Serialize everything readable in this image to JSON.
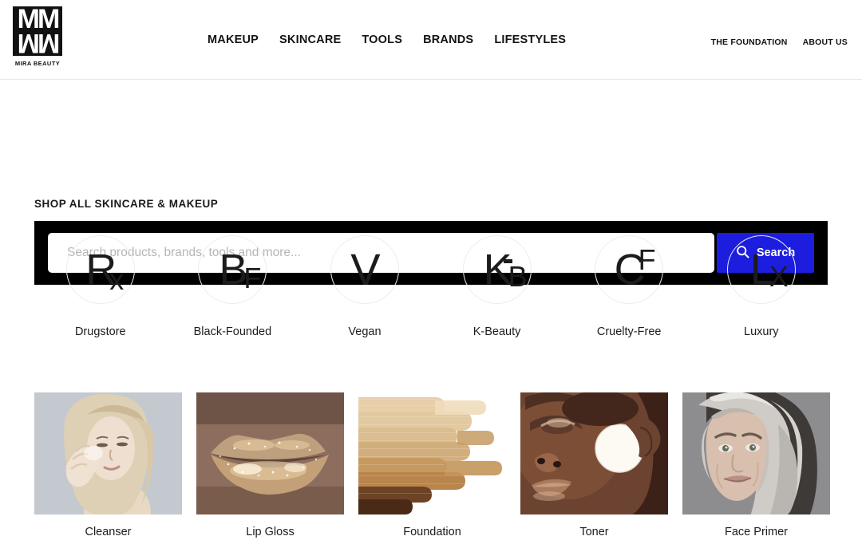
{
  "header": {
    "logo": {
      "mark_top": "MM",
      "mark_bottom": "MM",
      "wordmark": "MIRA BEAUTY"
    },
    "nav": [
      {
        "label": "MAKEUP"
      },
      {
        "label": "SKINCARE"
      },
      {
        "label": "TOOLS"
      },
      {
        "label": "BRANDS"
      },
      {
        "label": "LIFESTYLES"
      }
    ],
    "util_nav": [
      {
        "label": "THE FOUNDATION"
      },
      {
        "label": "ABOUT US"
      }
    ]
  },
  "search": {
    "section_title": "SHOP ALL SKINCARE & MAKEUP",
    "placeholder": "Search products, brands, tools and more...",
    "value": "",
    "button_label": "Search",
    "button_icon": "search-icon",
    "button_color": "#1d1de0",
    "band_color": "#000000"
  },
  "categories": [
    {
      "label": "Drugstore",
      "icon": "rx-monogram-icon",
      "glyph_main": "R",
      "glyph_sub": "x"
    },
    {
      "label": "Black-Founded",
      "icon": "bf-monogram-icon",
      "glyph_main": "B",
      "glyph_sub": "F"
    },
    {
      "label": "Vegan",
      "icon": "v-monogram-icon",
      "glyph_main": "V",
      "glyph_sub": ""
    },
    {
      "label": "K-Beauty",
      "icon": "kb-monogram-icon",
      "glyph_main": "K",
      "glyph_sub": "B"
    },
    {
      "label": "Cruelty-Free",
      "icon": "cf-monogram-icon",
      "glyph_main": "C",
      "glyph_sub": "F"
    },
    {
      "label": "Luxury",
      "icon": "lx-monogram-icon",
      "glyph_main": "L",
      "glyph_sub": "X"
    }
  ],
  "products": [
    {
      "label": "Cleanser",
      "image": "woman-applying-cleanser-photo"
    },
    {
      "label": "Lip Gloss",
      "image": "glossy-lips-closeup-photo"
    },
    {
      "label": "Foundation",
      "image": "foundation-shade-swatches-photo"
    },
    {
      "label": "Toner",
      "image": "woman-with-cotton-pad-photo"
    },
    {
      "label": "Face Primer",
      "image": "mature-woman-portrait-photo"
    }
  ]
}
